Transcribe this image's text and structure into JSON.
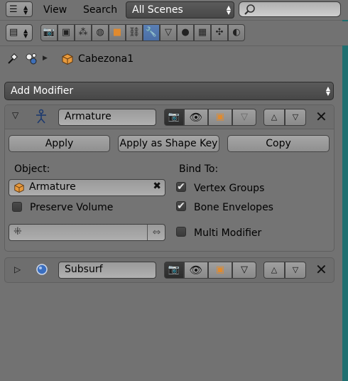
{
  "header": {
    "menu_view": "View",
    "menu_search": "Search",
    "scene_select": "All Scenes"
  },
  "context": {
    "object_name": "Cabezona1"
  },
  "add_modifier": {
    "label": "Add Modifier"
  },
  "modifiers": [
    {
      "name": "Armature",
      "expanded": true,
      "buttons": {
        "apply": "Apply",
        "apply_shape_key": "Apply as Shape Key",
        "copy": "Copy"
      },
      "object_label": "Object:",
      "object_value": "Armature",
      "bind_to_label": "Bind To:",
      "vertex_groups_label": "Vertex Groups",
      "vertex_groups_checked": true,
      "bone_envelopes_label": "Bone Envelopes",
      "bone_envelopes_checked": true,
      "preserve_volume_label": "Preserve Volume",
      "preserve_volume_checked": false,
      "multi_modifier_label": "Multi Modifier",
      "multi_modifier_checked": false
    },
    {
      "name": "Subsurf",
      "expanded": false
    }
  ],
  "colors": {
    "background": "#727272",
    "active_tab": "#5a7fb5",
    "edge_strip": "#1f6f70"
  }
}
